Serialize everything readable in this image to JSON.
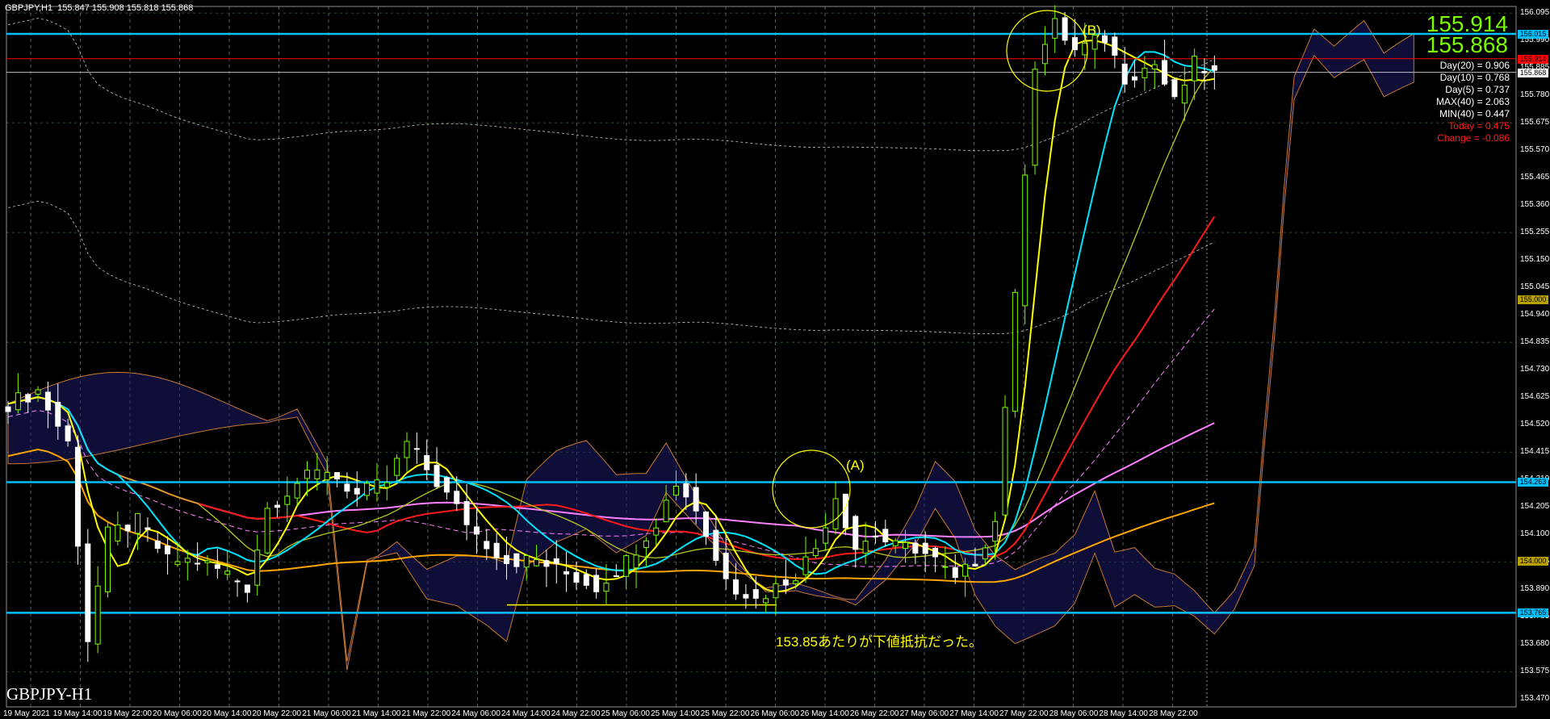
{
  "header": {
    "symbol": "GBPJPY,H1",
    "ohlc": "155.847 155.908 155.818 155.868"
  },
  "symbol_label": "GBPJPY-H1",
  "current_prices": {
    "bid": "155.914",
    "ask": "155.868"
  },
  "stats": [
    {
      "text": "Day(20) = 0.906",
      "color": "#ffffff"
    },
    {
      "text": "Day(10) = 0.768",
      "color": "#ffffff"
    },
    {
      "text": "Day(5) = 0.737",
      "color": "#ffffff"
    },
    {
      "text": "MAX(40) = 2.063",
      "color": "#ffffff"
    },
    {
      "text": "MIN(40) = 0.447",
      "color": "#ffffff"
    },
    {
      "text": "Today = 0.475",
      "color": "#ff2020"
    },
    {
      "text": "Change = -0.086",
      "color": "#ff2020"
    }
  ],
  "annotations": {
    "a": "(A)",
    "b": "(B)",
    "note": "153.85あたりが下値抵抗だった。"
  },
  "colors": {
    "background": "#000000",
    "bull_candle": "#7CFC00",
    "bear_candle": "#ffffff",
    "hline_cyan": "#00bfff",
    "hline_red": "#ff0000",
    "ma_yellow": "#ffff00",
    "ma_cyan": "#00e5ff",
    "ma_red": "#ff1a1a",
    "ma_pink": "#ff80ff",
    "ma_orange": "#ffa500"
  },
  "price_tags": [
    {
      "label": "156.015",
      "price": 156.015,
      "bg": "#00bfff"
    },
    {
      "label": "155.914",
      "price": 155.92,
      "bg": "#ff0000"
    },
    {
      "label": "155.868",
      "price": 155.868,
      "bg": "#ffffff"
    },
    {
      "label": "155.000",
      "price": 155.0,
      "bg": "#b8a000"
    },
    {
      "label": "154.263",
      "price": 154.3,
      "bg": "#00bfff"
    },
    {
      "label": "154.000",
      "price": 154.0,
      "bg": "#b8a000"
    },
    {
      "label": "153.765",
      "price": 153.8,
      "bg": "#00bfff"
    }
  ],
  "chart_data": {
    "type": "candlestick",
    "symbol": "GBPJPY",
    "timeframe": "H1",
    "y_ticks": [
      "156.095",
      "155.990",
      "155.885",
      "155.780",
      "155.675",
      "155.570",
      "155.465",
      "155.360",
      "155.255",
      "155.150",
      "155.045",
      "154.940",
      "154.835",
      "154.730",
      "154.625",
      "154.520",
      "154.415",
      "154.310",
      "154.205",
      "154.100",
      "153.995",
      "153.890",
      "153.785",
      "153.680",
      "153.575",
      "153.470"
    ],
    "x_ticks": [
      "19 May 2021",
      "19 May 14:00",
      "19 May 22:00",
      "20 May 06:00",
      "20 May 14:00",
      "20 May 22:00",
      "21 May 06:00",
      "21 May 14:00",
      "21 May 22:00",
      "24 May 06:00",
      "24 May 14:00",
      "24 May 22:00",
      "25 May 06:00",
      "25 May 14:00",
      "25 May 22:00",
      "26 May 06:00",
      "26 May 14:00",
      "26 May 22:00",
      "27 May 06:00",
      "27 May 14:00",
      "27 May 22:00",
      "28 May 06:00",
      "28 May 14:00",
      "28 May 22:00"
    ],
    "ylim": [
      153.44,
      156.12
    ],
    "horizontal_levels": [
      {
        "price": 156.015,
        "color": "#00bfff"
      },
      {
        "price": 155.92,
        "color": "#ff0000"
      },
      {
        "price": 155.868,
        "color": "#c0c0c0"
      },
      {
        "price": 154.3,
        "color": "#00bfff"
      },
      {
        "price": 153.8,
        "color": "#00bfff"
      }
    ],
    "close_path": [
      [
        0,
        154.6
      ],
      [
        3,
        154.65
      ],
      [
        6,
        154.45
      ],
      [
        8,
        153.7
      ],
      [
        10,
        154.1
      ],
      [
        13,
        154.15
      ],
      [
        16,
        154.0
      ],
      [
        19,
        154.0
      ],
      [
        22,
        153.95
      ],
      [
        24,
        153.9
      ],
      [
        26,
        154.2
      ],
      [
        29,
        154.3
      ],
      [
        32,
        154.35
      ],
      [
        35,
        154.25
      ],
      [
        38,
        154.3
      ],
      [
        40,
        154.45
      ],
      [
        42,
        154.35
      ],
      [
        44,
        154.25
      ],
      [
        47,
        154.1
      ],
      [
        50,
        154.0
      ],
      [
        53,
        154.0
      ],
      [
        56,
        153.95
      ],
      [
        59,
        153.9
      ],
      [
        62,
        154.0
      ],
      [
        65,
        154.15
      ],
      [
        67,
        154.3
      ],
      [
        69,
        154.2
      ],
      [
        71,
        154.0
      ],
      [
        73,
        153.9
      ],
      [
        75,
        153.85
      ],
      [
        77,
        153.9
      ],
      [
        79,
        153.95
      ],
      [
        81,
        154.05
      ],
      [
        83,
        154.25
      ],
      [
        85,
        154.05
      ],
      [
        87,
        154.1
      ],
      [
        89,
        154.05
      ],
      [
        91,
        154.05
      ],
      [
        93,
        154.0
      ],
      [
        95,
        153.92
      ],
      [
        97,
        154.0
      ],
      [
        99,
        154.15
      ],
      [
        100,
        154.6
      ],
      [
        101,
        155.0
      ],
      [
        102,
        155.5
      ],
      [
        103,
        155.9
      ],
      [
        105,
        156.05
      ],
      [
        107,
        155.95
      ],
      [
        110,
        156.0
      ],
      [
        112,
        155.85
      ],
      [
        115,
        155.9
      ],
      [
        117,
        155.75
      ],
      [
        119,
        155.9
      ],
      [
        121,
        155.86
      ]
    ]
  }
}
